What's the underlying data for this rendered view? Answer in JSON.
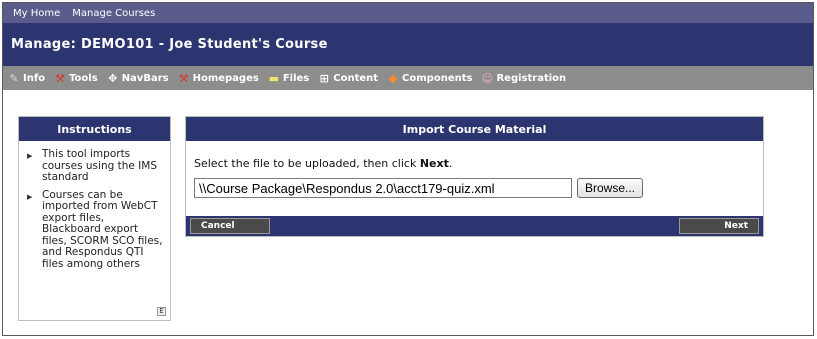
{
  "topnav": {
    "links": [
      "My Home",
      "Manage Courses"
    ]
  },
  "header": {
    "title": "Manage: DEMO101 - Joe Student's Course"
  },
  "toolbar": {
    "items": [
      {
        "label": "Info",
        "icon": "edit-icon"
      },
      {
        "label": "Tools",
        "icon": "wrench-icon"
      },
      {
        "label": "NavBars",
        "icon": "move-arrows-icon"
      },
      {
        "label": "Homepages",
        "icon": "wrench-icon"
      },
      {
        "label": "Files",
        "icon": "folder-icon"
      },
      {
        "label": "Content",
        "icon": "sitemap-icon"
      },
      {
        "label": "Components",
        "icon": "components-icon"
      },
      {
        "label": "Registration",
        "icon": "people-icon"
      }
    ]
  },
  "sidebar": {
    "title": "Instructions",
    "items": [
      "This tool imports courses using the IMS standard",
      "Courses can be imported from WebCT export files, Blackboard export files, SCORM SCO files, and Respondus QTI files among others"
    ],
    "edit_mark": "E"
  },
  "panel": {
    "title": "Import Course Material",
    "instruction_prefix": "Select the file to be uploaded, then click ",
    "instruction_bold": "Next",
    "instruction_suffix": ".",
    "file_value": "\\\\Course Package\\Respondus 2.0\\acct179-quiz.xml",
    "browse_label": "Browse...",
    "cancel_label": "Cancel",
    "next_label": "Next"
  },
  "colors": {
    "topnav_bg": "#5a5d8c",
    "header_bg": "#2d3570",
    "toolbar_bg": "#8d8d8d"
  }
}
